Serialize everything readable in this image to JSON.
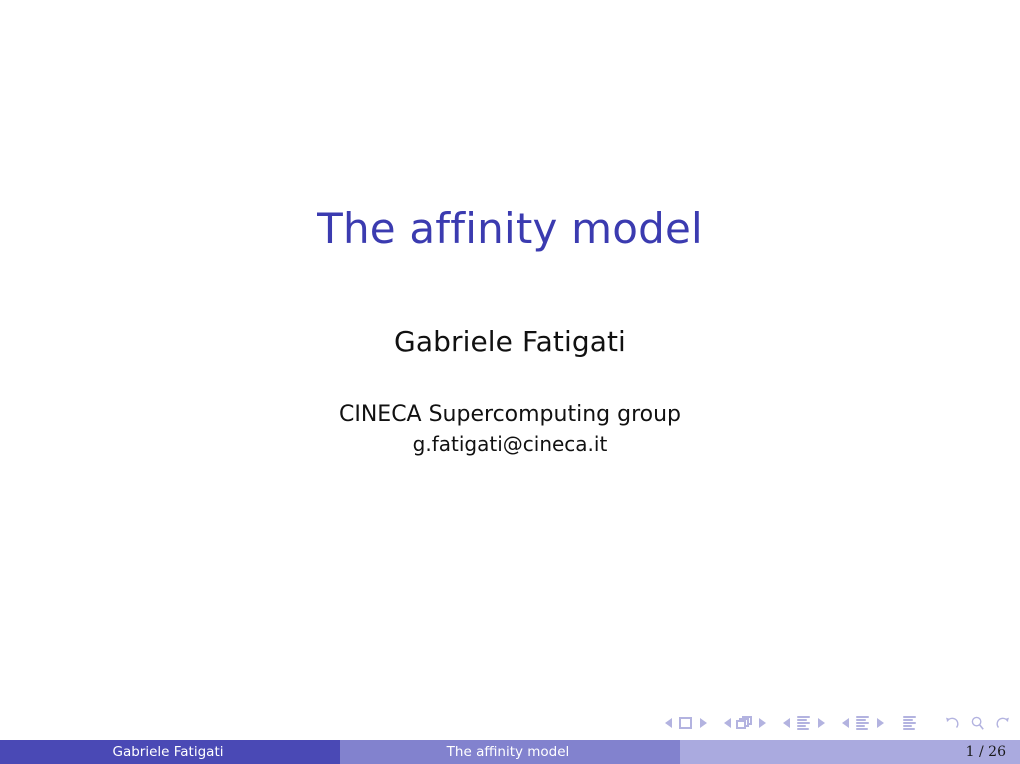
{
  "slide": {
    "title": "The affinity model",
    "author": "Gabriele Fatigati",
    "institute_line1": "CINECA Supercomputing group",
    "institute_line2": "g.fatigati@cineca.it"
  },
  "footer": {
    "author": "Gabriele Fatigati",
    "title": "The affinity model",
    "page": "1 / 26"
  },
  "navigation": {
    "slide_prev": "previous-slide",
    "slide_icon": "slide-icon",
    "slide_next": "next-slide",
    "frame_prev": "previous-frame",
    "frame_icon": "frame-icon",
    "frame_next": "next-frame",
    "subsection_prev": "previous-subsection",
    "subsection_icon": "subsection-icon",
    "subsection_next": "next-subsection",
    "section_prev": "previous-section",
    "section_icon": "section-icon",
    "section_next": "next-section",
    "presentation_icon": "presentation-icon",
    "back_icon": "back-icon",
    "find_icon": "find-icon",
    "forward_icon": "forward-icon"
  },
  "colors": {
    "title_blue": "#3b3bb0",
    "footer_dark": "#4a49b5",
    "footer_mid": "#8282ce",
    "footer_light": "#aaaadf",
    "nav_symbol": "#b3b3e0"
  }
}
